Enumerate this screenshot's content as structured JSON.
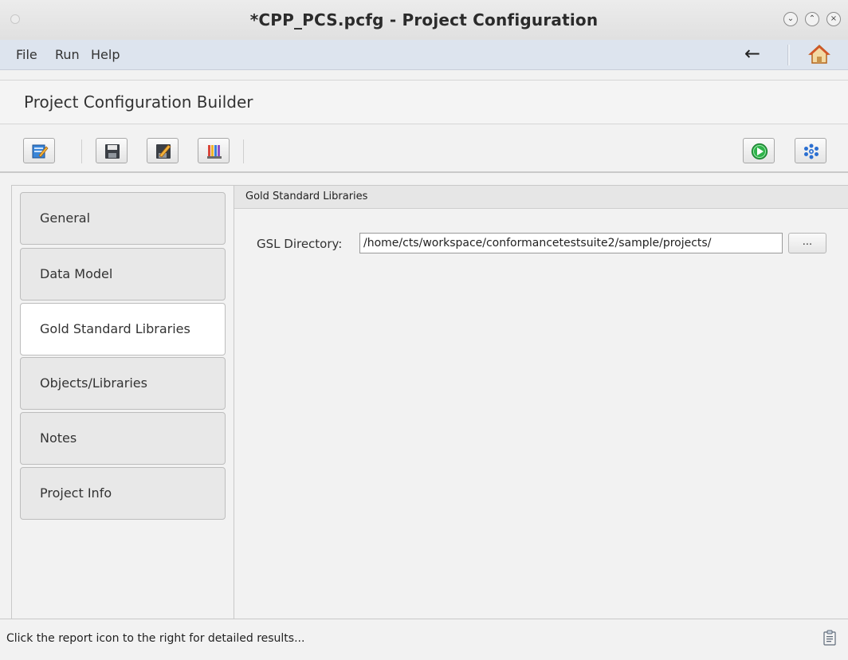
{
  "window": {
    "title": "*CPP_PCS.pcfg - Project Configuration",
    "controls": [
      "minimize",
      "maximize",
      "close"
    ]
  },
  "menubar": {
    "items": [
      {
        "label": "File"
      },
      {
        "label": "Run"
      },
      {
        "label": "Help"
      }
    ],
    "back_icon": "←",
    "home_icon": "home-icon"
  },
  "header": {
    "title": "Project Configuration Builder"
  },
  "toolbar": {
    "left_buttons": [
      "edit-icon",
      "save-icon",
      "save-as-icon",
      "libraries-icon"
    ],
    "right_buttons": [
      "run-icon",
      "settings-icon"
    ]
  },
  "sidebar": {
    "tabs": [
      {
        "label": "General",
        "active": false
      },
      {
        "label": "Data Model",
        "active": false
      },
      {
        "label": "Gold Standard Libraries",
        "active": true
      },
      {
        "label": "Objects/Libraries",
        "active": false
      },
      {
        "label": "Notes",
        "active": false
      },
      {
        "label": "Project Info",
        "active": false
      }
    ]
  },
  "content": {
    "section_title": "Gold Standard Libraries",
    "gsl_label": "GSL Directory:",
    "gsl_value": "/home/cts/workspace/conformancetestsuite2/sample/projects/",
    "browse_label": "..."
  },
  "statusbar": {
    "text": "Click the report icon to the right for detailed results...",
    "icon": "report-icon"
  },
  "colors": {
    "menubar_bg": "#dde4ee",
    "run_green": "#2fb34a",
    "settings_blue": "#2b6fd1"
  }
}
